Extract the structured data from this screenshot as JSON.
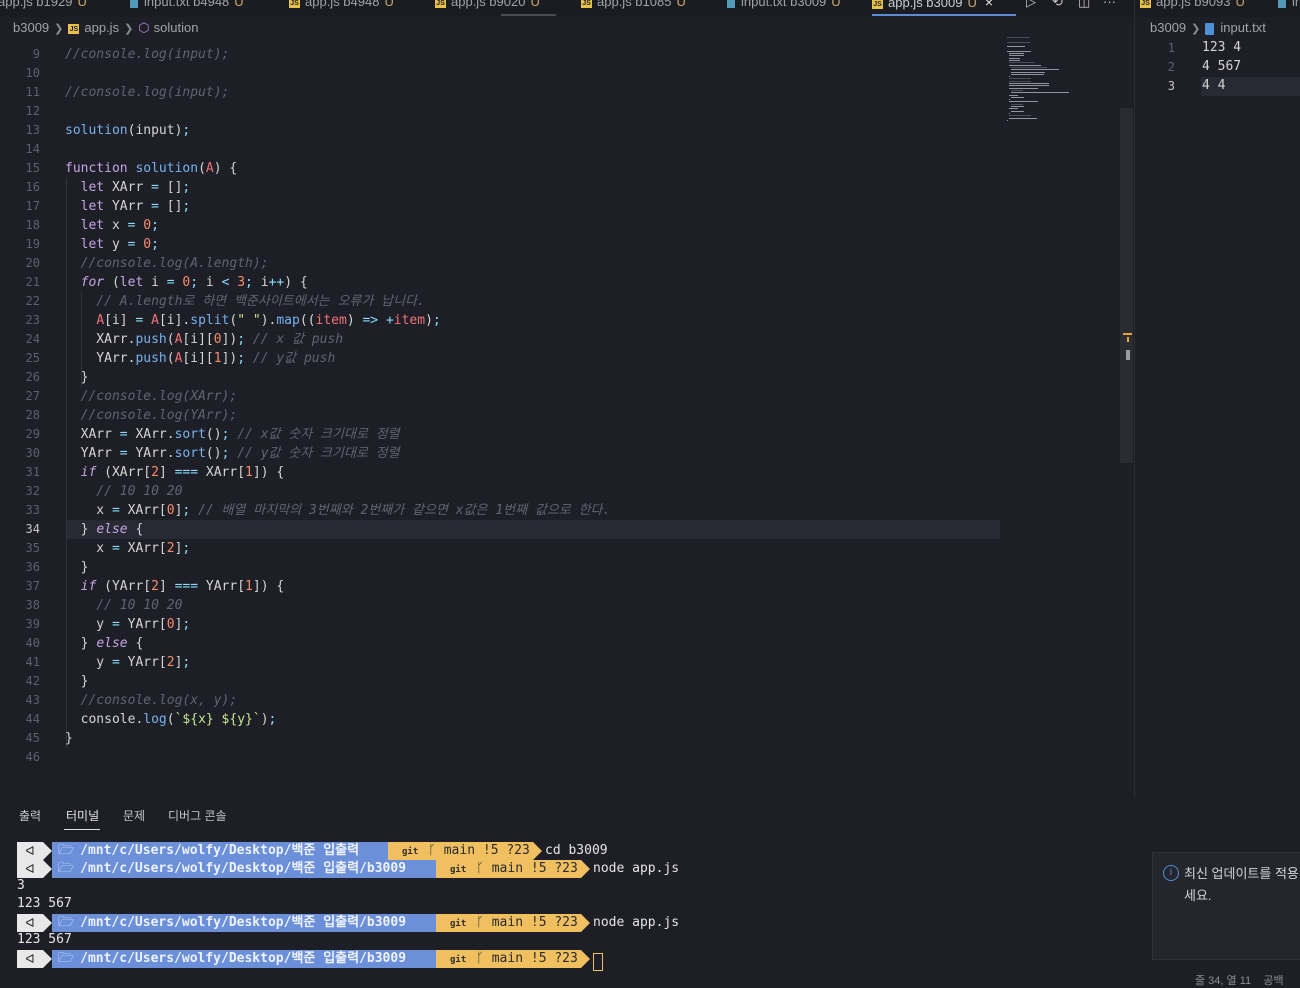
{
  "tabs": [
    {
      "label": "app.js b1929",
      "badge": "U",
      "icon": "js"
    },
    {
      "label": "input.txt b4948",
      "badge": "U",
      "icon": "file"
    },
    {
      "label": "app.js b4948",
      "badge": "U",
      "icon": "js"
    },
    {
      "label": "app.js b9020",
      "badge": "U",
      "icon": "js"
    },
    {
      "label": "app.js b1085",
      "badge": "U",
      "icon": "js"
    },
    {
      "label": "input.txt b3009",
      "badge": "U",
      "icon": "file"
    },
    {
      "label": "app.js b3009",
      "badge": "U",
      "icon": "js",
      "active": true
    },
    {
      "label": "app.js b9093",
      "badge": "U",
      "icon": "js"
    },
    {
      "label": "in",
      "icon": "file"
    }
  ],
  "tab_close": "×",
  "breadcrumb_left": {
    "folder": "b3009",
    "file": "app.js",
    "symbol": "solution"
  },
  "breadcrumb_right": {
    "folder": "b3009",
    "file": "input.txt"
  },
  "editor": {
    "line_numbers": [
      "9",
      "10",
      "11",
      "12",
      "13",
      "14",
      "15",
      "16",
      "17",
      "18",
      "19",
      "20",
      "21",
      "22",
      "23",
      "24",
      "25",
      "26",
      "27",
      "28",
      "29",
      "30",
      "31",
      "32",
      "33",
      "34",
      "35",
      "36",
      "37",
      "38",
      "39",
      "40",
      "41",
      "42",
      "43",
      "44",
      "45",
      "46"
    ],
    "current_line": "34",
    "code": [
      "//console.log(input);",
      "",
      "//console.log(input);",
      "",
      "solution(input);",
      "",
      "function solution(A) {",
      "  let XArr = [];",
      "  let YArr = [];",
      "  let x = 0;",
      "  let y = 0;",
      "  //console.log(A.length);",
      "  for (let i = 0; i < 3; i++) {",
      "    // A.length로 하면 백준사이트에서는 오류가 납니다.",
      "    A[i] = A[i].split(\" \").map((item) => +item);",
      "    XArr.push(A[i][0]); // x 값 push",
      "    YArr.push(A[i][1]); // y값 push",
      "  }",
      "  //console.log(XArr);",
      "  //console.log(YArr);",
      "  XArr = XArr.sort(); // x값 숫자 크기대로 정렬",
      "  YArr = YArr.sort(); // y값 숫자 크기대로 정렬",
      "  if (XArr[2] === XArr[1]) {",
      "    // 10 10 20",
      "    x = XArr[0]; // 배열 마지막의 3번째와 2번째가 같으면 x값은 1번째 값으로 한다.",
      "  } else {",
      "    x = XArr[2];",
      "  }",
      "  if (YArr[2] === YArr[1]) {",
      "    // 10 10 20",
      "    y = YArr[0];",
      "  } else {",
      "    y = YArr[2];",
      "  }",
      "  //console.log(x, y);",
      "  console.log(`${x} ${y}`);",
      "}",
      ""
    ]
  },
  "input_file": {
    "line_numbers": [
      "1",
      "2",
      "3"
    ],
    "lines": [
      "123 4",
      "4 567",
      "4 4"
    ]
  },
  "panel": {
    "tabs": [
      "출력",
      "터미널",
      "문제",
      "디버그 콘솔"
    ],
    "active_tab": "터미널"
  },
  "terminal": {
    "prompts": [
      {
        "path": "/mnt/c/Users/wolfy/Desktop/백준 입출력",
        "git": "git",
        "branch": "main !5 ?23",
        "command": "cd b3009"
      },
      {
        "path": "/mnt/c/Users/wolfy/Desktop/백준 입출력/b3009",
        "git": "git",
        "branch": "main !5 ?23",
        "command": "node app.js"
      },
      {
        "path": "/mnt/c/Users/wolfy/Desktop/백준 입출력/b3009",
        "git": "git",
        "branch": "main !5 ?23",
        "command": "node app.js"
      },
      {
        "path": "/mnt/c/Users/wolfy/Desktop/백준 입출력/b3009",
        "git": "git",
        "branch": "main !5 ?23",
        "command": ""
      }
    ],
    "outputs": [
      "3",
      "123 567",
      "123 567"
    ]
  },
  "notification": {
    "message_line1": "최신 업데이트를 적용",
    "message_line2": "세요."
  },
  "status_bar": {
    "position": "줄 34, 열 11",
    "spaces": "공백"
  },
  "colors": {
    "accent": "#5a8dd6",
    "prompt_path": "#6b8fd8",
    "prompt_git": "#f0c060",
    "prompt_os": "#e8e8e8"
  }
}
